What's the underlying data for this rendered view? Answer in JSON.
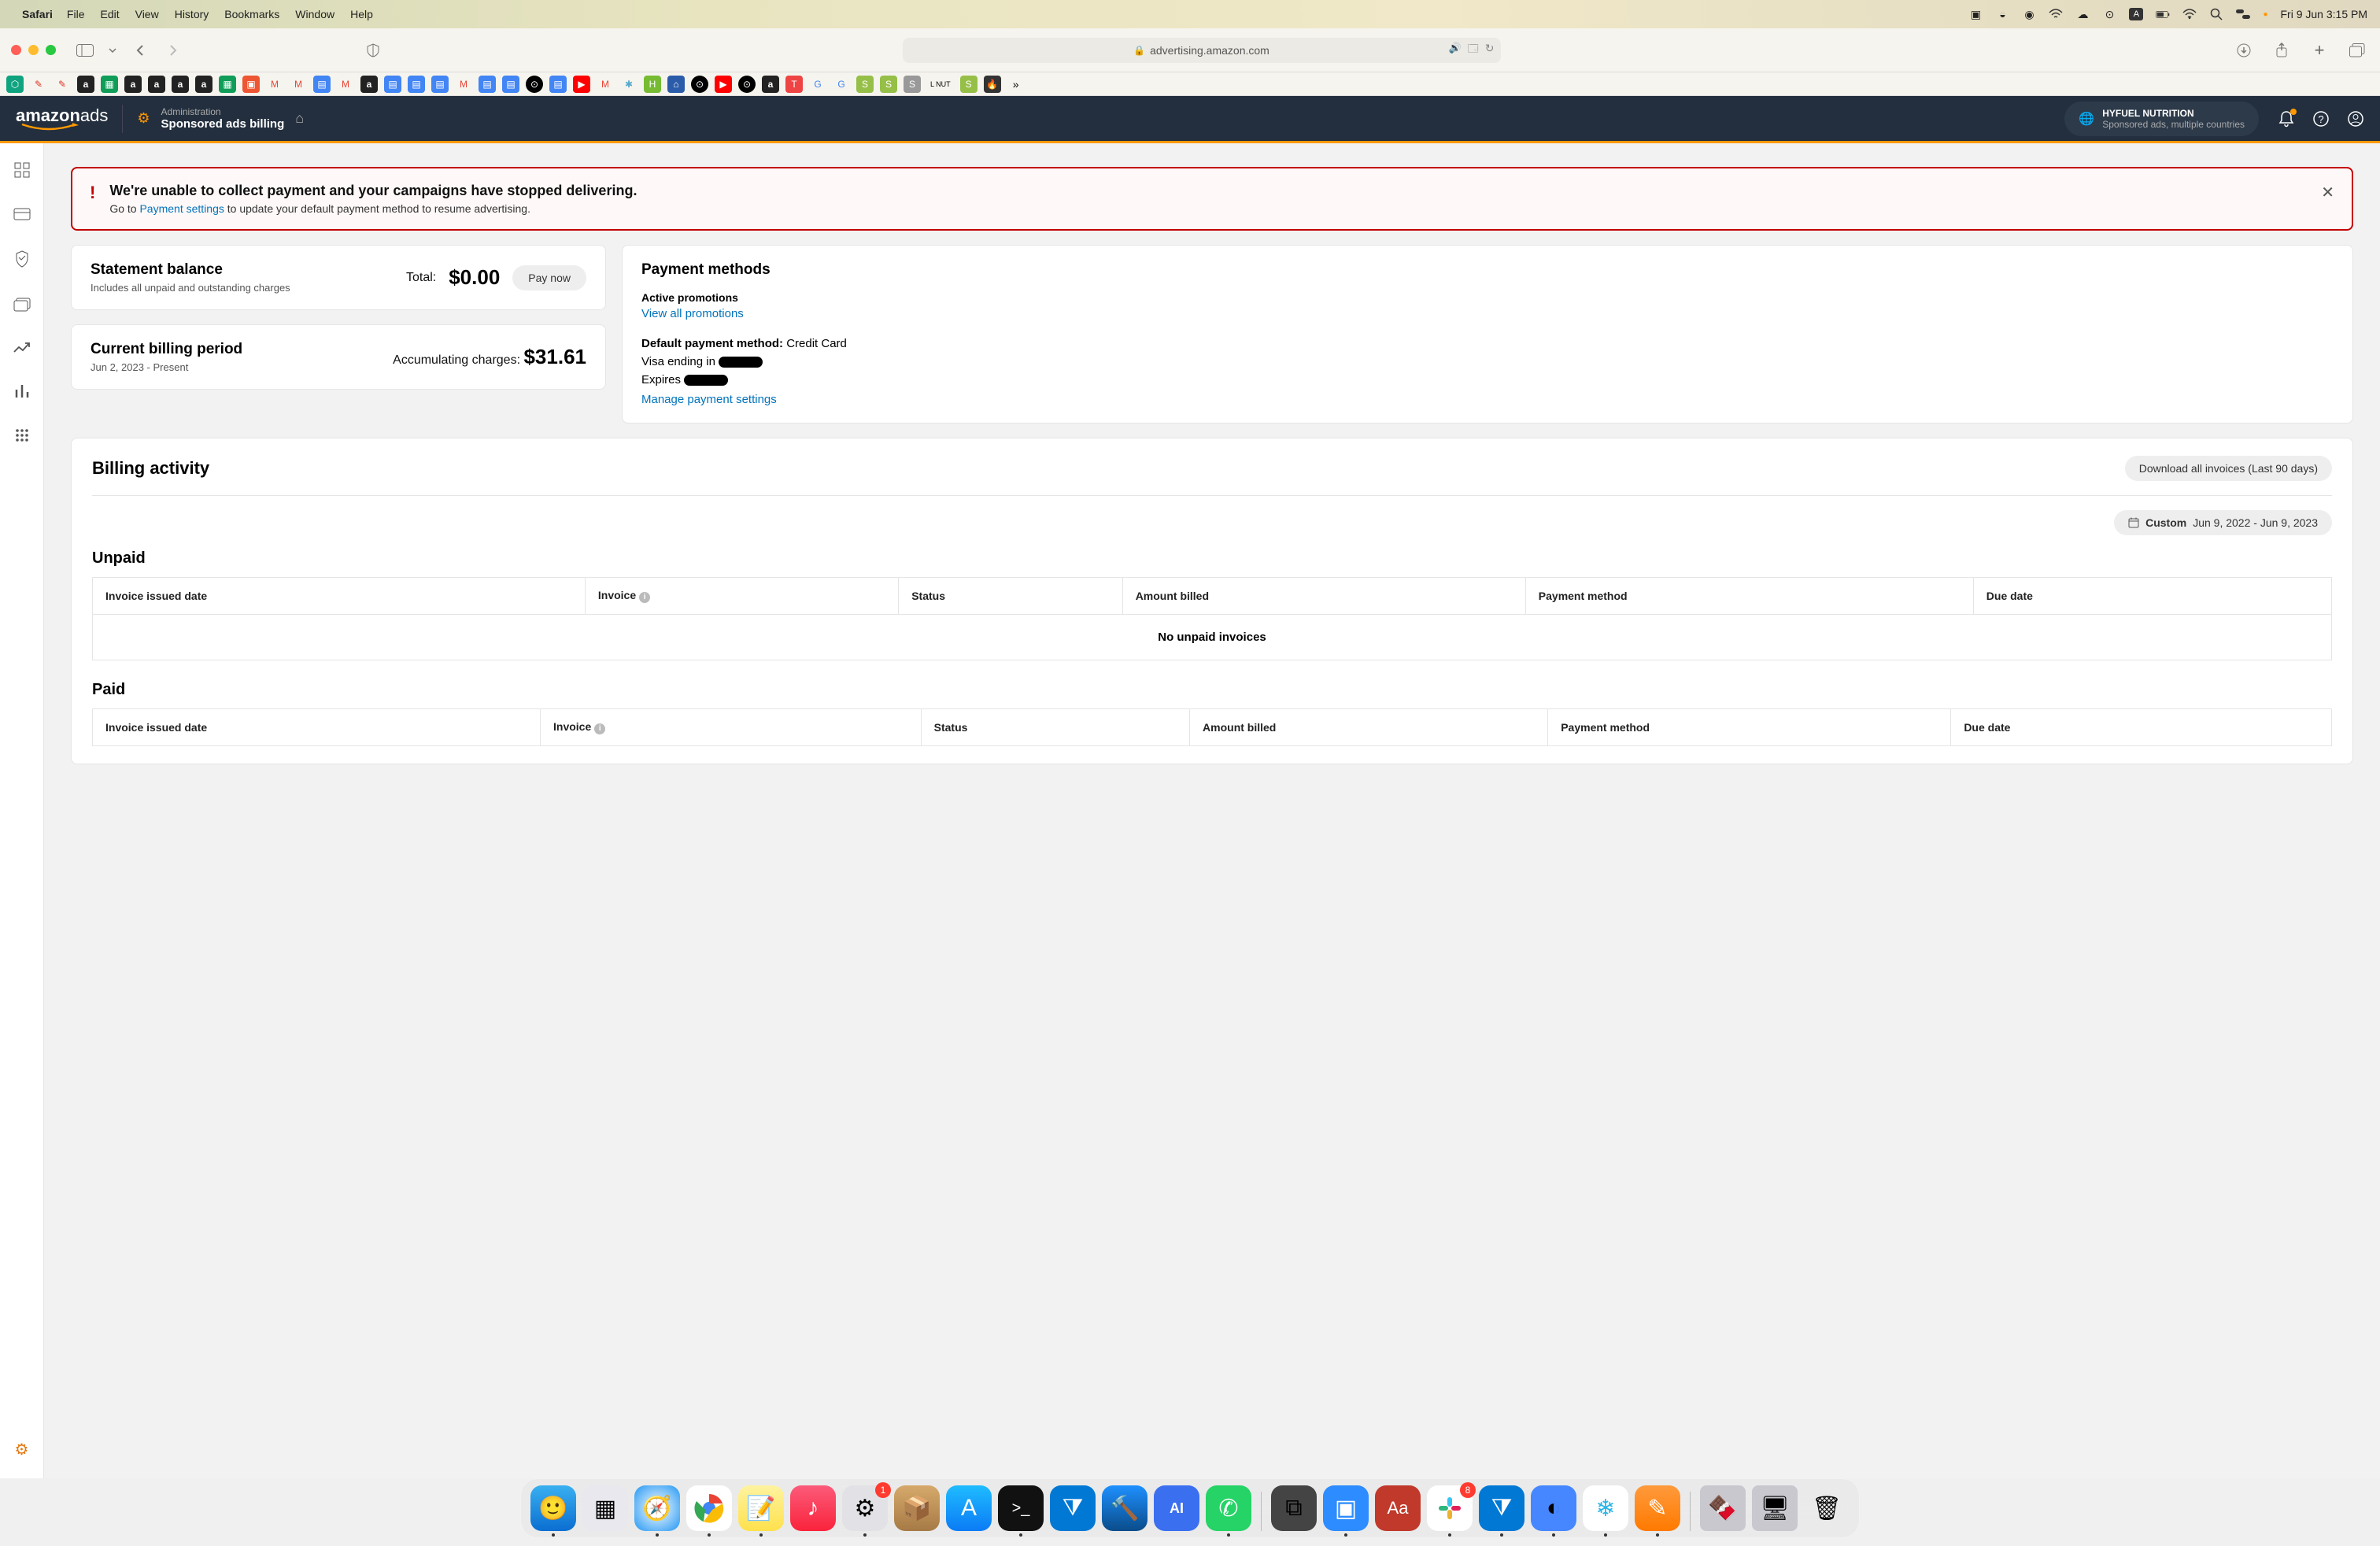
{
  "menubar": {
    "app": "Safari",
    "items": [
      "File",
      "Edit",
      "View",
      "History",
      "Bookmarks",
      "Window",
      "Help"
    ],
    "datetime": "Fri 9 Jun  3:15 PM"
  },
  "safari": {
    "url": "advertising.amazon.com"
  },
  "header": {
    "logo_text": "amazon",
    "logo_text2": "ads",
    "admin_label": "Administration",
    "page_title": "Sponsored ads billing",
    "account_name": "HYFUEL NUTRITION",
    "account_sub": "Sponsored ads, multiple countries"
  },
  "alert": {
    "title": "We're unable to collect payment and your campaigns have stopped delivering.",
    "pre_link": "Go to ",
    "link": "Payment settings",
    "post_link": " to update your default payment method to resume advertising."
  },
  "statement": {
    "title": "Statement balance",
    "sub": "Includes all unpaid and outstanding charges",
    "total_label": "Total:",
    "total": "$0.00",
    "pay_btn": "Pay now"
  },
  "period": {
    "title": "Current billing period",
    "sub": "Jun 2, 2023 - Present",
    "accum_label": "Accumulating charges:",
    "accum_val": "$31.61"
  },
  "payment_methods": {
    "title": "Payment methods",
    "active_label": "Active promotions",
    "view_all": "View all promotions",
    "default_label": "Default payment method:",
    "default_value": "Credit Card",
    "visa_line": "Visa ending in",
    "expires_line": "Expires",
    "manage_link": "Manage payment settings"
  },
  "billing": {
    "title": "Billing activity",
    "download_btn": "Download all invoices (Last 90 days)",
    "range_prefix": "Custom",
    "range_value": "Jun 9, 2022 - Jun 9, 2023",
    "unpaid_title": "Unpaid",
    "paid_title": "Paid",
    "columns": [
      "Invoice issued date",
      "Invoice",
      "Status",
      "Amount billed",
      "Payment method",
      "Due date"
    ],
    "no_unpaid": "No unpaid invoices"
  },
  "dock": {
    "settings_badge": "1",
    "slack_badge": "8"
  }
}
